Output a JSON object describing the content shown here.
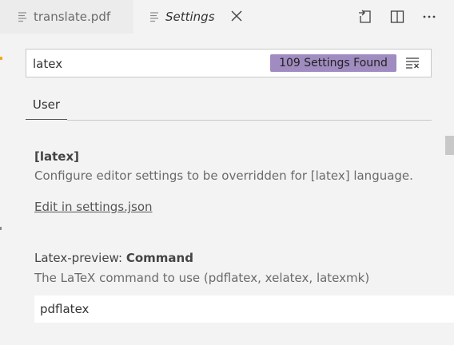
{
  "tabs": [
    {
      "label": "translate.pdf",
      "active": false,
      "icon": "file-lines-icon"
    },
    {
      "label": "Settings",
      "active": true,
      "icon": "file-lines-icon"
    }
  ],
  "toolbar": {
    "actions": [
      "open-settings-json-icon",
      "split-editor-icon",
      "more-actions-icon"
    ]
  },
  "search": {
    "value": "latex",
    "results_badge": "109 Settings Found"
  },
  "scope_tabs": [
    {
      "label": "User",
      "active": true
    }
  ],
  "settings": [
    {
      "title_category": "",
      "title_name": "[latex]",
      "description": "Configure editor settings to be overridden for [latex] language.",
      "link": "Edit in settings.json"
    },
    {
      "title_category": "Latex-preview: ",
      "title_name": "Command",
      "description": "The LaTeX command to use (pdflatex, xelatex, latexmk)",
      "value": "pdflatex"
    }
  ],
  "colors": {
    "badge_bg": "#a08cc0",
    "accent": "#f5a623",
    "background": "#f3f3f3"
  }
}
